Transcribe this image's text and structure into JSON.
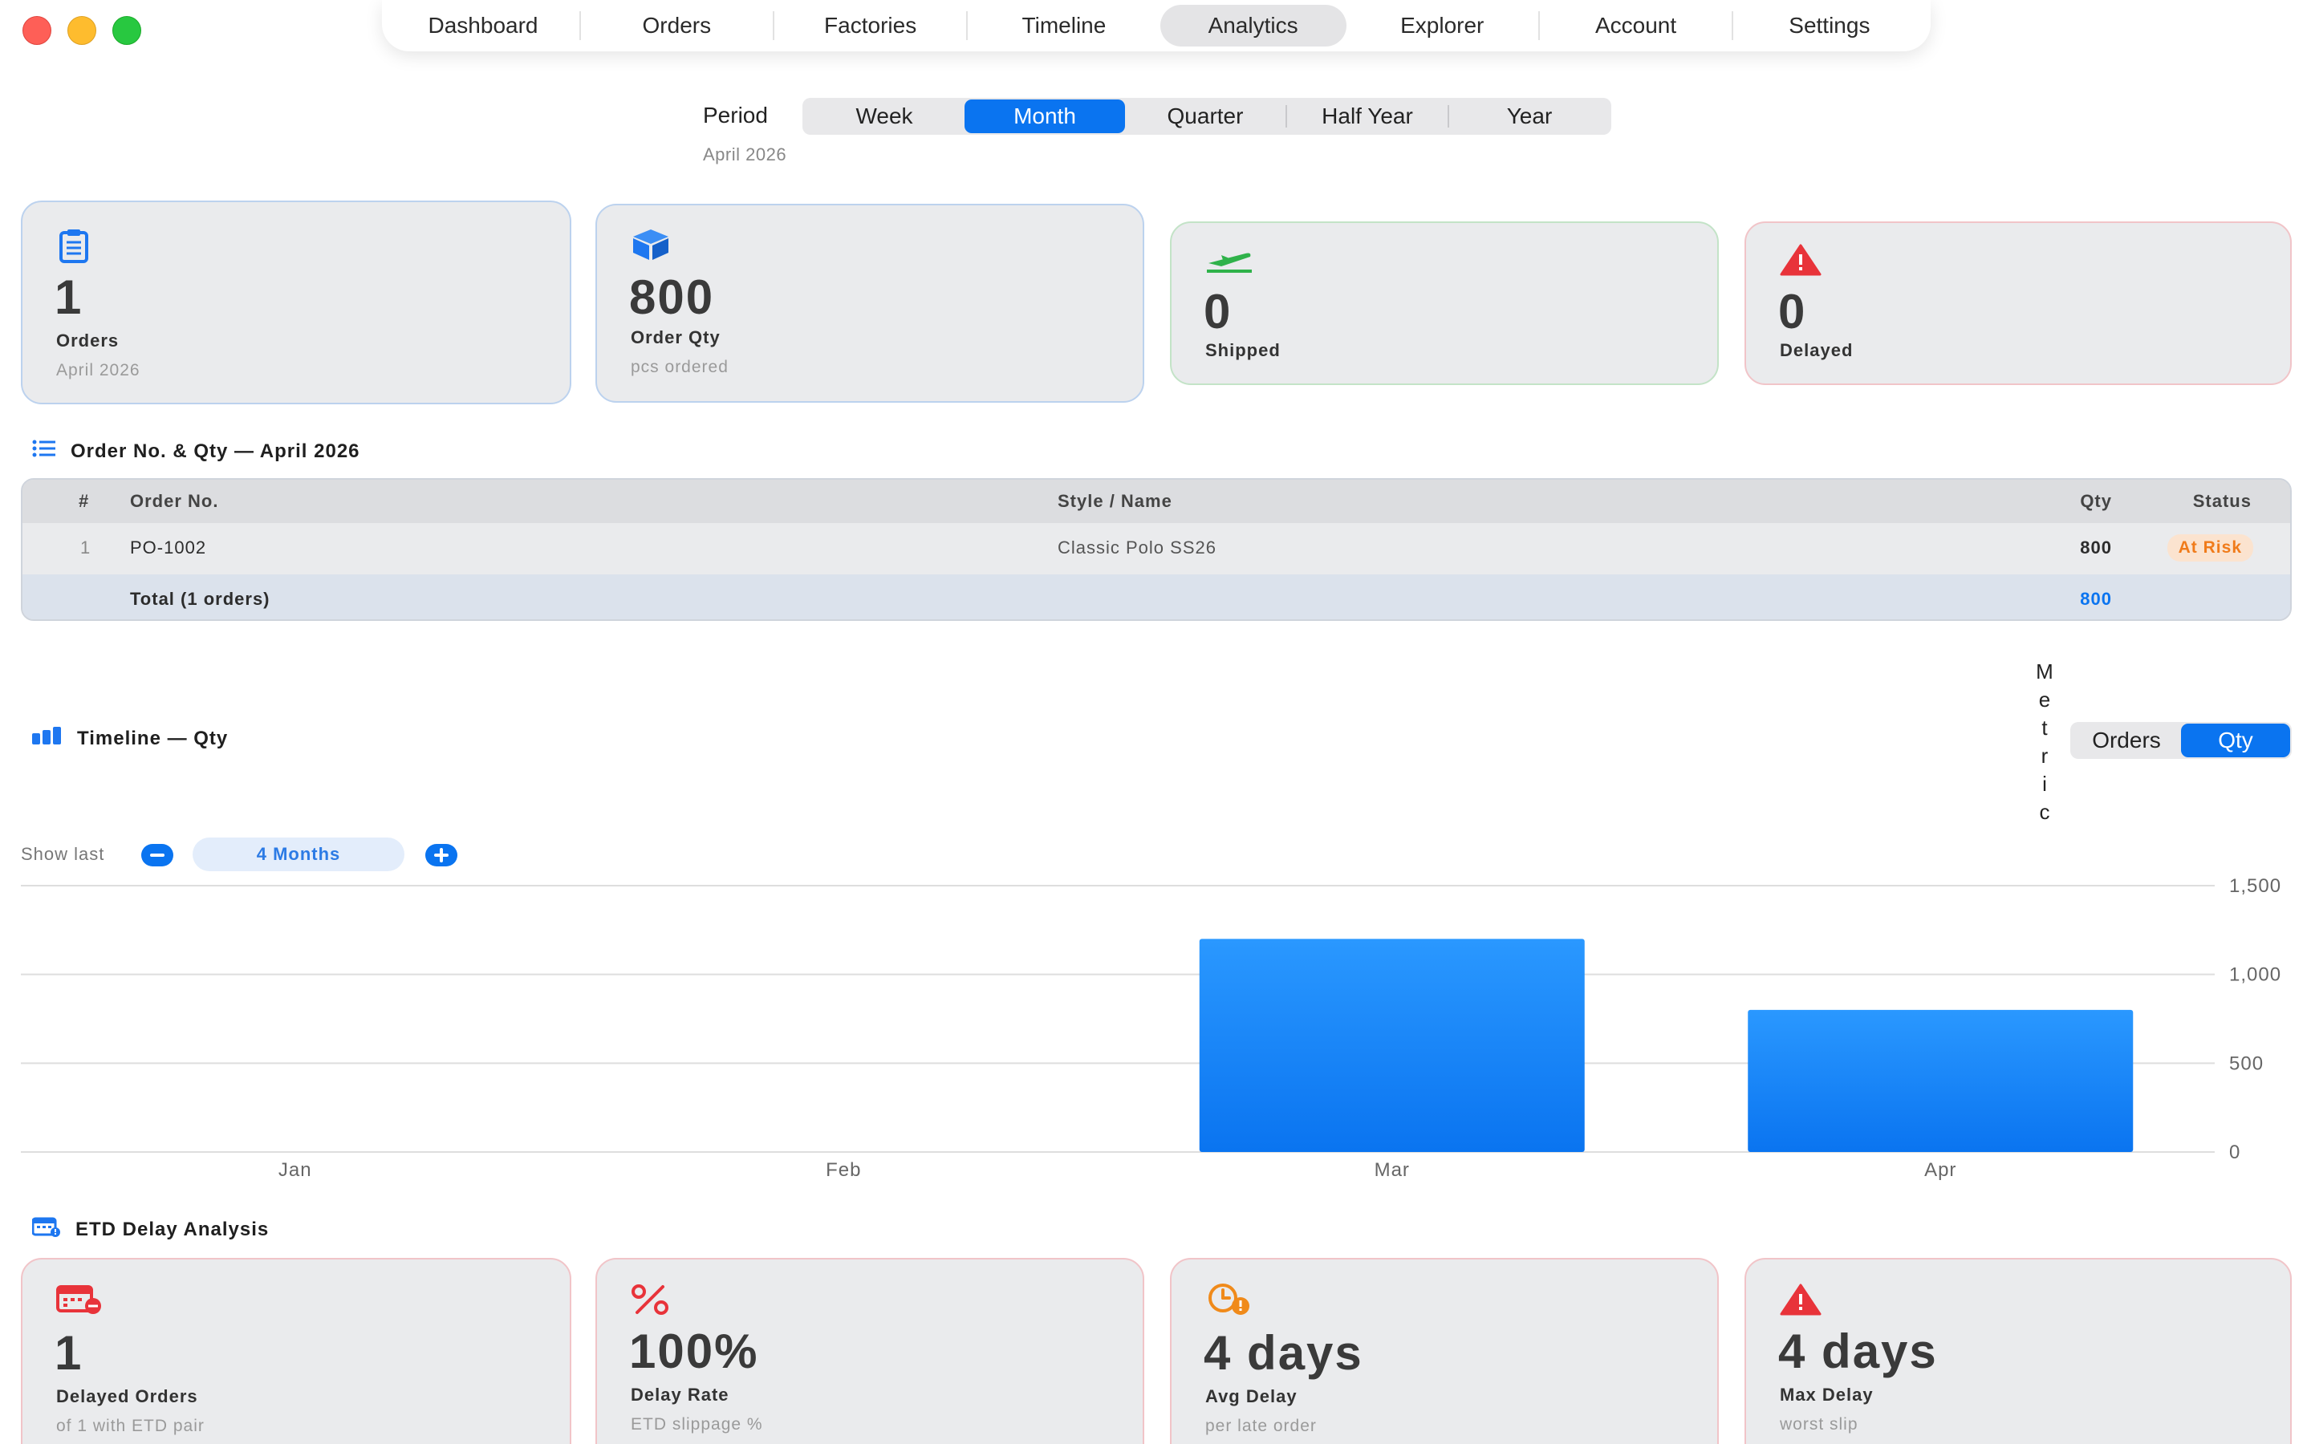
{
  "nav": {
    "items": [
      "Dashboard",
      "Orders",
      "Factories",
      "Timeline",
      "Analytics",
      "Explorer",
      "Account",
      "Settings"
    ],
    "active": "Analytics"
  },
  "period": {
    "label": "Period",
    "options": [
      "Week",
      "Month",
      "Quarter",
      "Half Year",
      "Year"
    ],
    "active": "Month",
    "subtitle": "April 2026"
  },
  "stats": [
    {
      "value": "1",
      "label": "Orders",
      "sub": "April 2026",
      "icon": "clipboard-icon",
      "color": "#1e77f0"
    },
    {
      "value": "800",
      "label": "Order Qty",
      "sub": "pcs ordered",
      "icon": "cube-icon",
      "color": "#1e77f0"
    },
    {
      "value": "0",
      "label": "Shipped",
      "sub": "",
      "icon": "airplane-icon",
      "color": "#2fb24a"
    },
    {
      "value": "0",
      "label": "Delayed",
      "sub": "",
      "icon": "warning-icon",
      "color": "#e8333a"
    }
  ],
  "orders_section": {
    "title": "Order No. & Qty — April 2026",
    "columns": [
      "#",
      "Order No.",
      "Style / Name",
      "Qty",
      "Status"
    ],
    "rows": [
      {
        "num": "1",
        "order_no": "PO-1002",
        "style": "Classic Polo SS26",
        "qty": "800",
        "status": "At Risk"
      }
    ],
    "total_label": "Total (1 orders)",
    "total_qty": "800"
  },
  "timeline_section": {
    "title": "Timeline — Qty",
    "metric_label": "Metric",
    "metric_options": [
      "Orders",
      "Qty"
    ],
    "metric_active": "Qty",
    "show_last_label": "Show last",
    "range_value": "4 Months"
  },
  "chart_data": {
    "type": "bar",
    "categories": [
      "Jan",
      "Feb",
      "Mar",
      "Apr"
    ],
    "values": [
      0,
      0,
      1200,
      800
    ],
    "ylim": [
      0,
      1500
    ],
    "yticks": [
      "0",
      "500",
      "1,000",
      "1,500"
    ],
    "ytick_values": [
      0,
      500,
      1000,
      1500
    ],
    "grid": true,
    "bar_color": "#0a74f0"
  },
  "delay_section": {
    "title": "ETD Delay Analysis",
    "cards": [
      {
        "value": "1",
        "label": "Delayed Orders",
        "sub": "of 1 with ETD pair",
        "icon": "calendar-x-icon",
        "color": "#e8333a"
      },
      {
        "value": "100%",
        "label": "Delay Rate",
        "sub": "ETD slippage %",
        "icon": "percent-icon",
        "color": "#e8333a"
      },
      {
        "value": "4 days",
        "label": "Avg Delay",
        "sub": "per late order",
        "icon": "clock-alert-icon",
        "color": "#f08a1a"
      },
      {
        "value": "4 days",
        "label": "Max Delay",
        "sub": "worst slip",
        "icon": "warning-icon",
        "color": "#e8333a"
      }
    ]
  }
}
